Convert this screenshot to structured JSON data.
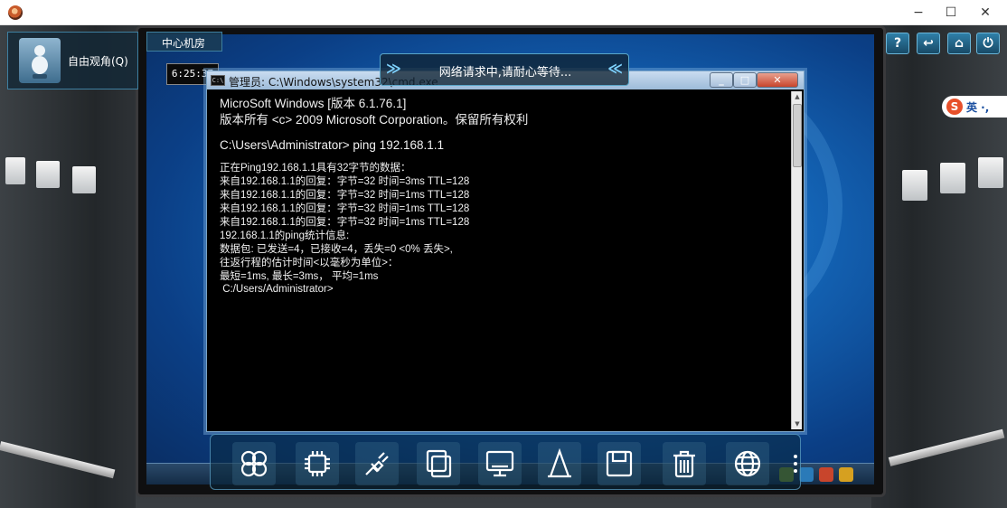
{
  "window_controls": {
    "minimize_icon": "minimize-icon",
    "maximize_icon": "maximize-icon",
    "close_icon": "close-icon",
    "minimize_glyph": "−",
    "maximize_glyph": "☐",
    "close_glyph": "✕"
  },
  "hud": {
    "free_view_label": "自由观角(Q)",
    "room_label": "中心机房",
    "clock": "6:25:37"
  },
  "banner": {
    "text": "网络请求中,请耐心等待...",
    "left_chevron": "≫",
    "right_chevron": "≪"
  },
  "toolbar_right": {
    "help": "?",
    "back": "↩",
    "home": "⌂",
    "power": "⏻"
  },
  "ime": {
    "logo": "S",
    "label": "英 ·,"
  },
  "cmd": {
    "title": "管理员: C:\\Windows\\system32\\cmd.exe",
    "title_icon": "C:\\",
    "lines": [
      "MicroSoft Windows [版本 6.1.76.1]",
      "版本所有 <c> 2009 Microsoft Corporation。保留所有权利",
      "C:\\Users\\Administrator> ping 192.168.1.1",
      "正在Ping192.168.1.1具有32字节的数据：",
      "来自192.168.1.1的回复：字节=32 时间=3ms TTL=128",
      "来自192.168.1.1的回复：字节=32 时间=1ms TTL=128",
      "来自192.168.1.1的回复：字节=32 时间=1ms TTL=128",
      "来自192.168.1.1的回复：字节=32 时间=1ms TTL=128",
      "192.168.1.1的ping统计信息:",
      "数据包: 已发送=4，已接收=4，丢失=0 <0% 丢失>,",
      "往返行程的估计时间<以毫秒为单位>：",
      "最短=1ms, 最长=3ms， 平均=1ms",
      " C:/Users/Administrator>"
    ]
  },
  "dock": {
    "items": [
      "network-icon",
      "chip-icon",
      "plug-icon",
      "copy-icon",
      "monitor-icon",
      "text-icon",
      "save-icon",
      "trash-icon",
      "globe-icon"
    ]
  },
  "colors": {
    "accent": "#3e7fa0",
    "desktop": "#1466b8",
    "cmd_bg": "#000000",
    "cmd_text": "#f0f0f0"
  }
}
